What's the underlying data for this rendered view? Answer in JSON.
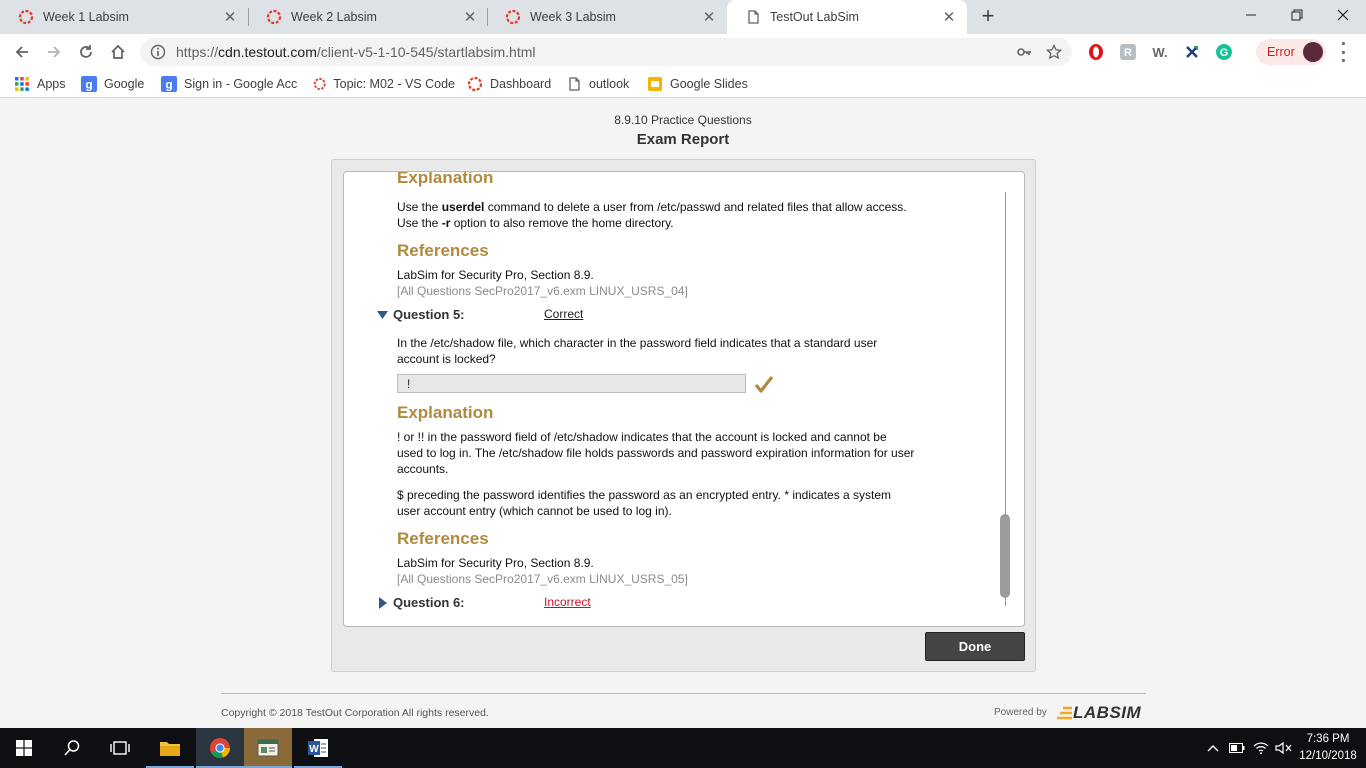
{
  "browser": {
    "tabs": [
      {
        "label": "Week 1 Labsim",
        "active": false
      },
      {
        "label": "Week 2 Labsim",
        "active": false
      },
      {
        "label": "Week 3 Labsim",
        "active": false
      },
      {
        "label": "TestOut LabSim",
        "active": true
      }
    ],
    "url_prefix": "https://",
    "url_host": "cdn.testout.com",
    "url_path": "/client-v5-1-10-545/startlabsim.html",
    "error_label": "Error",
    "bookmarks": [
      {
        "label": "Apps",
        "icon": "apps-grid-icon"
      },
      {
        "label": "Google",
        "icon": "google-icon"
      },
      {
        "label": "Sign in - Google Acc",
        "icon": "google-icon"
      },
      {
        "label": "Topic: M02 - VS Code",
        "icon": "canvas-icon"
      },
      {
        "label": "Dashboard",
        "icon": "canvas-icon"
      },
      {
        "label": "outlook",
        "icon": "page-icon"
      },
      {
        "label": "Google Slides",
        "icon": "slides-icon"
      }
    ]
  },
  "page": {
    "subtitle": "8.9.10 Practice Questions",
    "title": "Exam Report"
  },
  "report": {
    "q4_explanation_heading": "Explanation",
    "q4_exp_line1_pre": "Use the ",
    "q4_exp_line1_bold": "userdel",
    "q4_exp_line1_post": " command to delete a user from /etc/passwd and related files that allow access.",
    "q4_exp_line2_pre": "Use the ",
    "q4_exp_line2_bold": "-r",
    "q4_exp_line2_post": " option to also remove the home directory.",
    "q4_references_heading": "References",
    "q4_ref_line": "LabSim for Security Pro, Section 8.9.",
    "q4_ref_id": "[All Questions SecPro2017_v6.exm LINUX_USRS_04]",
    "q5": {
      "label": "Question 5:",
      "status": "Correct",
      "text_line1": "In the /etc/shadow file, which character in the password field indicates that a standard user",
      "text_line2": "account is locked?",
      "answer": "!",
      "explanation_heading": "Explanation",
      "exp_p1_l1": "! or !! in the password field of /etc/shadow indicates that the account is locked and cannot be",
      "exp_p1_l2": "used to log in. The /etc/shadow file holds passwords and password expiration information for user",
      "exp_p1_l3": "accounts.",
      "exp_p2_l1": "$ preceding the password identifies the password as an encrypted entry. * indicates a system",
      "exp_p2_l2": "user account entry (which cannot be used to log in).",
      "references_heading": "References",
      "ref_line": "LabSim for Security Pro, Section 8.9.",
      "ref_id": "[All Questions SecPro2017_v6.exm LINUX_USRS_05]"
    },
    "q6": {
      "label": "Question 6:",
      "status": "Incorrect"
    }
  },
  "done_label": "Done",
  "footer": {
    "copyright": "Copyright © 2018  TestOut Corporation All rights reserved.",
    "powered_by": "Powered by",
    "logo_text": "LABSIM"
  },
  "taskbar": {
    "time": "7:36 PM",
    "date": "12/10/2018"
  },
  "colors": {
    "heading_gold": "#b08a3e",
    "correct": "#222222",
    "incorrect": "#c8102e",
    "checkmark": "#b5863b"
  }
}
